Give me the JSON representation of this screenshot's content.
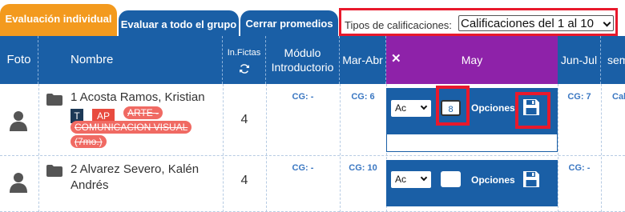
{
  "tabs": [
    {
      "label": "Evaluación individual"
    },
    {
      "label": "Evaluar a todo el grupo"
    },
    {
      "label": "Cerrar promedios"
    }
  ],
  "grade_types": {
    "label": "Tipos de calificaciones:",
    "selected": "Calificaciones del 1 al 10"
  },
  "columns": {
    "foto": "Foto",
    "nombre": "Nombre",
    "fictas": "In.Fictas",
    "modulo": "Módulo Introductorio",
    "mar_abr": "Mar-Abr",
    "may": "May",
    "jun_jul": "Jun-Jul",
    "sem": "sem"
  },
  "students": [
    {
      "name": "1 Acosta Ramos, Kristian",
      "badges": [
        "T",
        "AP"
      ],
      "course": "ARTE - COMUNICACION VISUAL (7mo.)",
      "fichas": "4",
      "modulo_cg": "CG: -",
      "mar_abr_cg": "CG: 6",
      "may_select": "Ac",
      "may_grade": "8",
      "options_label": "Opciones",
      "jun_jul_cg": "CG: 7",
      "sem_cg": "Cal"
    },
    {
      "name": "2 Alvarez Severo, Kalén Andrés",
      "fichas": "4",
      "modulo_cg": "CG: -",
      "mar_abr_cg": "CG: 10",
      "may_select": "Ac",
      "may_grade": "",
      "options_label": "Opciones",
      "jun_jul_cg": "CG: -"
    }
  ],
  "colors": {
    "primary": "#1a5fa6",
    "tab_active": "#f39a1e",
    "may_header": "#8e22a9",
    "highlight": "#e8192c",
    "badge_t": "#1c3957",
    "badge_ap": "#e84b3f",
    "badge_course": "#f06a63",
    "cg_text": "#3a77c2"
  }
}
